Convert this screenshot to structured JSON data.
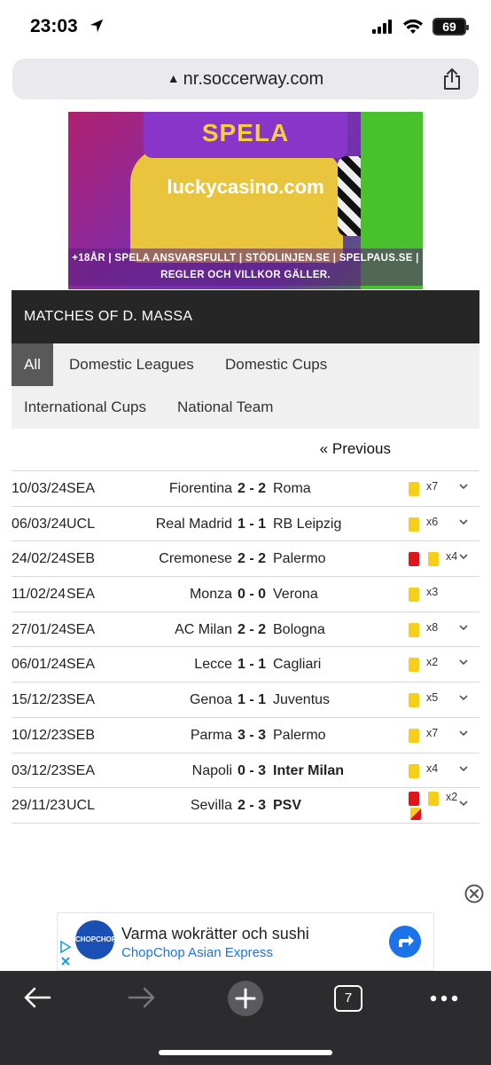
{
  "status_bar": {
    "time": "23:03",
    "battery": "69"
  },
  "browser": {
    "url": "nr.soccerway.com"
  },
  "ad_banner": {
    "cta": "SPELA",
    "site": "luckycasino.com",
    "disclaimer_line1": "+18ÅR | SPELA ANSVARSFULLT | STÖDLINJEN.SE | SPELPAUS.SE |",
    "disclaimer_line2": "REGLER OCH VILLKOR GÄLLER."
  },
  "section": {
    "title": "MATCHES OF D. MASSA"
  },
  "tabs": [
    {
      "label": "All",
      "active": true
    },
    {
      "label": "Domestic Leagues",
      "active": false
    },
    {
      "label": "Domestic Cups",
      "active": false
    },
    {
      "label": "International Cups",
      "active": false
    },
    {
      "label": "National Team",
      "active": false
    }
  ],
  "pagination": {
    "previous_label": "« Previous"
  },
  "matches": [
    {
      "date": "10/03/24",
      "competition": "SEA",
      "home": "Fiorentina",
      "score": "2 - 2",
      "away": "Roma",
      "away_bold": false,
      "cards": [
        "yellow"
      ],
      "count": "x7",
      "expandable": true
    },
    {
      "date": "06/03/24",
      "competition": "UCL",
      "home": "Real Madrid",
      "score": "1 - 1",
      "away": "RB Leipzig",
      "away_bold": false,
      "cards": [
        "yellow"
      ],
      "count": "x6",
      "expandable": true
    },
    {
      "date": "24/02/24",
      "competition": "SEB",
      "home": "Cremonese",
      "score": "2 - 2",
      "away": "Palermo",
      "away_bold": false,
      "cards": [
        "red",
        "yellow"
      ],
      "count": "x4",
      "expandable": true
    },
    {
      "date": "11/02/24",
      "competition": "SEA",
      "home": "Monza",
      "score": "0 - 0",
      "away": "Verona",
      "away_bold": false,
      "cards": [
        "yellow"
      ],
      "count": "x3",
      "expandable": false
    },
    {
      "date": "27/01/24",
      "competition": "SEA",
      "home": "AC Milan",
      "score": "2 - 2",
      "away": "Bologna",
      "away_bold": false,
      "cards": [
        "yellow"
      ],
      "count": "x8",
      "expandable": true
    },
    {
      "date": "06/01/24",
      "competition": "SEA",
      "home": "Lecce",
      "score": "1 - 1",
      "away": "Cagliari",
      "away_bold": false,
      "cards": [
        "yellow"
      ],
      "count": "x2",
      "expandable": true
    },
    {
      "date": "15/12/23",
      "competition": "SEA",
      "home": "Genoa",
      "score": "1 - 1",
      "away": "Juventus",
      "away_bold": false,
      "cards": [
        "yellow"
      ],
      "count": "x5",
      "expandable": true
    },
    {
      "date": "10/12/23",
      "competition": "SEB",
      "home": "Parma",
      "score": "3 - 3",
      "away": "Palermo",
      "away_bold": false,
      "cards": [
        "yellow"
      ],
      "count": "x7",
      "expandable": true
    },
    {
      "date": "03/12/23",
      "competition": "SEA",
      "home": "Napoli",
      "score": "0 - 3",
      "away": "Inter Milan",
      "away_bold": true,
      "cards": [
        "yellow"
      ],
      "count": "x4",
      "expandable": true
    },
    {
      "date": "29/11/23",
      "competition": "UCL",
      "home": "Sevilla",
      "score": "2 - 3",
      "away": "PSV",
      "away_bold": true,
      "cards": [
        "red",
        "yellow",
        "yellow-red"
      ],
      "count": "x2",
      "expandable": true
    }
  ],
  "bottom_ad": {
    "logo_text": "CHOPCHOP",
    "title": "Varma wokrätter och sushi",
    "subtitle": "ChopChop Asian Express"
  },
  "toolbar": {
    "tab_count": "7"
  },
  "colors": {
    "header_bg": "#262626",
    "tab_active": "#595959",
    "yellow_card": "#f6cf1a",
    "red_card": "#e0141b",
    "toolbar_bg": "#2c2c2e",
    "link_blue": "#1a73e8"
  }
}
